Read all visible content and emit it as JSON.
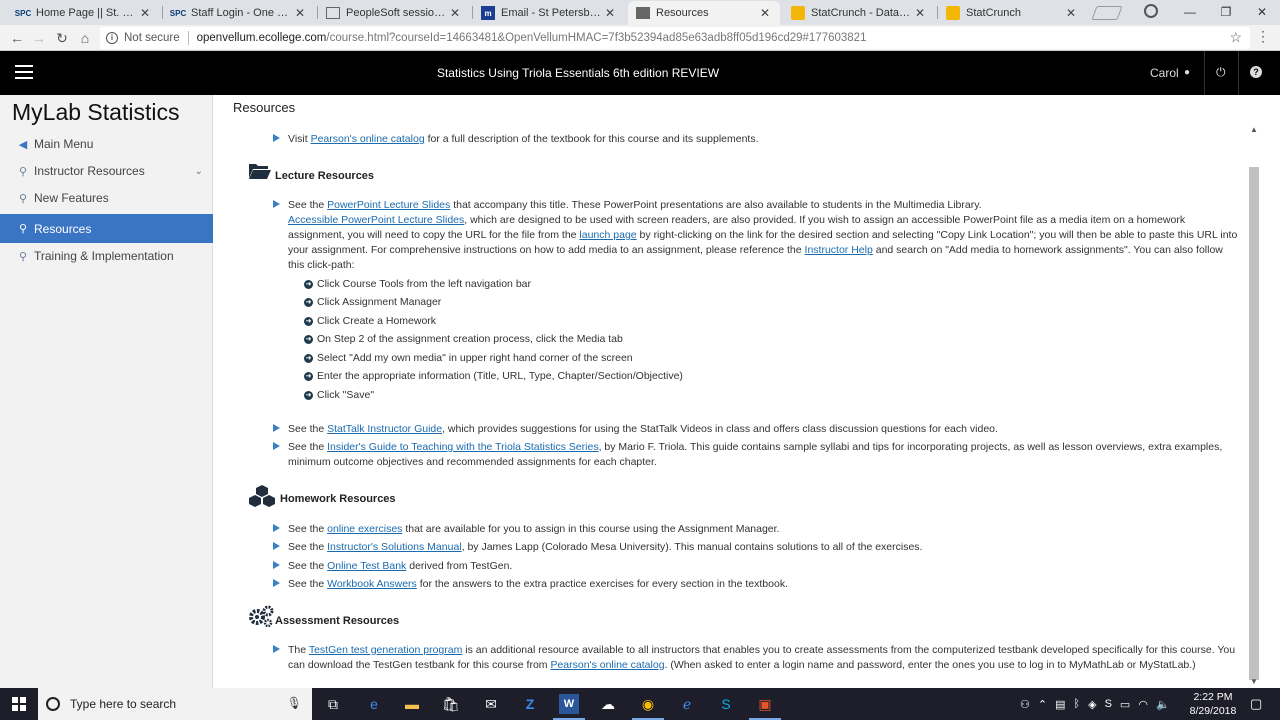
{
  "browser": {
    "tabs": [
      {
        "label": "Home Page || St. Petersbu",
        "favicon": "SPC"
      },
      {
        "label": "Staff Login - One SPC",
        "favicon": "SPC"
      },
      {
        "label": "PeopleSoft session expire",
        "favicon": "doc"
      },
      {
        "label": "Email - St Petersburg Coll",
        "favicon": "mail"
      },
      {
        "label": "Resources",
        "favicon": "page"
      },
      {
        "label": "StatCrunch - Data analysi",
        "favicon": "sc"
      },
      {
        "label": "StatCrunch",
        "favicon": "sc"
      }
    ],
    "not_secure": "Not secure",
    "url_host": "openvellum.ecollege.com",
    "url_path": "/course.html?courseId=14663481&OpenVellumHMAC=7f3b52394ad85e63adb8ff05d196cd29#177603821"
  },
  "header": {
    "course_title": "Statistics Using Triola Essentials 6th edition REVIEW",
    "user_name": "Carol"
  },
  "sidebar": {
    "brand": "MyLab Statistics",
    "items": [
      {
        "label": "Main Menu"
      },
      {
        "label": "Instructor Resources"
      },
      {
        "label": "New Features"
      },
      {
        "label": "Resources"
      },
      {
        "label": "Training & Implementation"
      }
    ]
  },
  "main": {
    "title": "Resources",
    "intro": {
      "pre": "Visit ",
      "link": "Pearson's online catalog",
      "post": " for a full description of the textbook for this course and its supplements."
    },
    "lecture": {
      "heading": "Lecture Resources",
      "p1_pre": "See the ",
      "p1_link": "PowerPoint Lecture Slides",
      "p1_post": " that accompany this title. These PowerPoint presentations are also available to students in the Multimedia Library.",
      "p1_link2": "Accessible PowerPoint Lecture Slides",
      "p1_mid": ", which are designed to be used with screen readers, are also provided. If you wish to assign an accessible PowerPoint file as a media item on a homework assignment, you will need to copy the URL for the file from the ",
      "p1_link3": "launch page",
      "p1_mid2": " by right-clicking on the link for the desired section and selecting \"Copy Link Location\"; you will then be able to paste this URL into your assignment. For comprehensive instructions on how to add media to an assignment, please reference the ",
      "p1_link4": "Instructor Help",
      "p1_end": " and search on \"Add media to homework assignments\". You can also follow this click-path:",
      "steps": [
        "Click Course Tools from the left navigation bar",
        "Click Assignment Manager",
        "Click Create a Homework",
        "On Step 2 of the assignment creation process, click the Media tab",
        "Select \"Add my own media\" in upper right hand corner of the screen",
        "Enter the appropriate information (Title, URL, Type, Chapter/Section/Objective)",
        "Click \"Save\""
      ],
      "p2_pre": "See the ",
      "p2_link": "StatTalk Instructor Guide",
      "p2_post": ", which provides suggestions for using the StatTalk Videos in class and offers class discussion questions for each video.",
      "p3_pre": "See the ",
      "p3_link": "Insider's Guide to Teaching with the Triola Statistics Series",
      "p3_post": ", by Mario F. Triola. This guide contains sample syllabi and tips for incorporating projects, as well as lesson overviews, extra examples, minimum outcome objectives and recommended assignments for each chapter."
    },
    "homework": {
      "heading": "Homework Resources",
      "items": [
        {
          "pre": "See the ",
          "link": "online exercises",
          "post": " that are available for you to assign in this course using the Assignment Manager."
        },
        {
          "pre": "See the ",
          "link": "Instructor's Solutions Manual",
          "post": ", by James Lapp (Colorado Mesa University). This manual contains solutions to all of the exercises."
        },
        {
          "pre": "See the ",
          "link": "Online Test Bank",
          "post": " derived from TestGen."
        },
        {
          "pre": "See the ",
          "link": "Workbook Answers",
          "post": " for the answers to the extra practice exercises for every section in the textbook."
        }
      ]
    },
    "assessment": {
      "heading": "Assessment Resources",
      "pre": "The ",
      "link": "TestGen test generation program",
      "mid": " is an additional resource available to all instructors that enables you to create assessments from the computerized testbank developed specifically for this course. You can download the TestGen testbank for this course from ",
      "link2": "Pearson's online catalog",
      "post": ". (When asked to enter a login name and password, enter the ones you use to log in to MyMathLab or MyStatLab.)"
    }
  },
  "taskbar": {
    "search_placeholder": "Type here to search",
    "time": "2:22 PM",
    "date": "8/29/2018"
  }
}
